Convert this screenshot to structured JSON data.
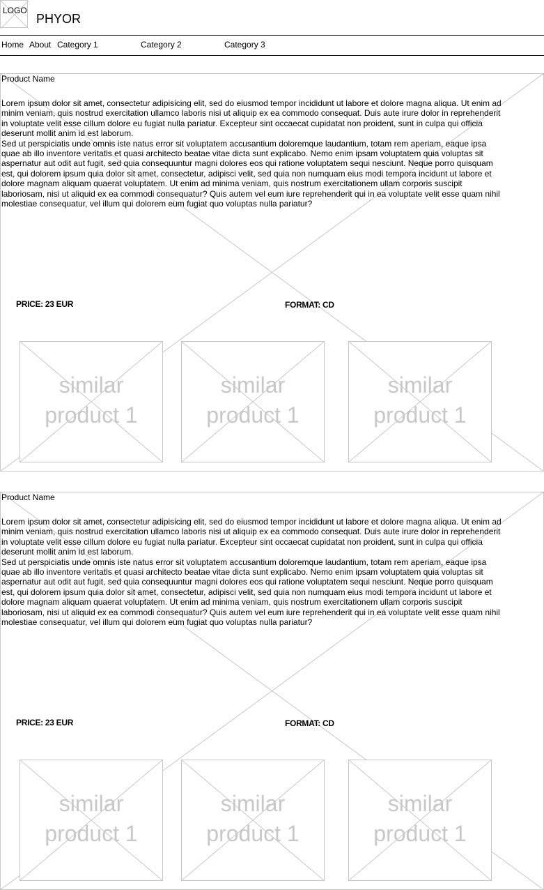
{
  "header": {
    "logo_label": "LOGO",
    "site_name": "PHYOR"
  },
  "nav": {
    "items": [
      {
        "label": "Home"
      },
      {
        "label": "About"
      },
      {
        "label": "Category 1"
      },
      {
        "label": "Category 2"
      },
      {
        "label": "Category 3"
      }
    ]
  },
  "products": [
    {
      "name": "Product Name",
      "paragraph1": "Lorem ipsum dolor sit amet, consectetur adipisicing elit, sed do eiusmod tempor incididunt ut labore et dolore magna aliqua. Ut enim ad minim veniam, quis nostrud exercitation ullamco laboris nisi ut aliquip ex ea commodo consequat. Duis aute irure dolor in reprehenderit in voluptate velit esse cillum dolore eu fugiat nulla pariatur. Excepteur sint occaecat cupidatat non proident, sunt in culpa qui officia deserunt mollit anim id est laborum.",
      "paragraph2": "Sed ut perspiciatis unde omnis iste natus error sit voluptatem accusantium doloremque laudantium, totam rem aperiam, eaque ipsa quae ab illo inventore veritatis et quasi architecto beatae vitae dicta sunt explicabo. Nemo enim ipsam voluptatem quia voluptas sit aspernatur aut odit aut fugit, sed quia consequuntur magni dolores eos qui ratione voluptatem sequi nesciunt. Neque porro quisquam est, qui dolorem ipsum quia dolor sit amet, consectetur, adipisci velit, sed quia non numquam eius modi tempora incidunt ut labore et dolore magnam aliquam quaerat voluptatem. Ut enim ad minima veniam, quis nostrum exercitationem ullam corporis suscipit laboriosam, nisi ut aliquid ex ea commodi consequatur? Quis autem vel eum iure reprehenderit qui in ea voluptate velit esse quam nihil molestiae consequatur, vel illum qui dolorem eum fugiat quo voluptas nulla pariatur?",
      "price": "PRICE: 23 EUR",
      "format": "FORMAT: CD",
      "similar": [
        {
          "line1": "similar",
          "line2": "product 1"
        },
        {
          "line1": "similar",
          "line2": "product 1"
        },
        {
          "line1": "similar",
          "line2": "product 1"
        }
      ]
    },
    {
      "name": "Product Name",
      "paragraph1": "Lorem ipsum dolor sit amet, consectetur adipisicing elit, sed do eiusmod tempor incididunt ut labore et dolore magna aliqua. Ut enim ad minim veniam, quis nostrud exercitation ullamco laboris nisi ut aliquip ex ea commodo consequat. Duis aute irure dolor in reprehenderit in voluptate velit esse cillum dolore eu fugiat nulla pariatur. Excepteur sint occaecat cupidatat non proident, sunt in culpa qui officia deserunt mollit anim id est laborum.",
      "paragraph2": "Sed ut perspiciatis unde omnis iste natus error sit voluptatem accusantium doloremque laudantium, totam rem aperiam, eaque ipsa quae ab illo inventore veritatis et quasi architecto beatae vitae dicta sunt explicabo. Nemo enim ipsam voluptatem quia voluptas sit aspernatur aut odit aut fugit, sed quia consequuntur magni dolores eos qui ratione voluptatem sequi nesciunt. Neque porro quisquam est, qui dolorem ipsum quia dolor sit amet, consectetur, adipisci velit, sed quia non numquam eius modi tempora incidunt ut labore et dolore magnam aliquam quaerat voluptatem. Ut enim ad minima veniam, quis nostrum exercitationem ullam corporis suscipit laboriosam, nisi ut aliquid ex ea commodi consequatur? Quis autem vel eum iure reprehenderit qui in ea voluptate velit esse quam nihil molestiae consequatur, vel illum qui dolorem eum fugiat quo voluptas nulla pariatur?",
      "price": "PRICE: 23 EUR",
      "format": "FORMAT: CD",
      "similar": [
        {
          "line1": "similar",
          "line2": "product 1"
        },
        {
          "line1": "similar",
          "line2": "product 1"
        },
        {
          "line1": "similar",
          "line2": "product 1"
        }
      ]
    }
  ]
}
